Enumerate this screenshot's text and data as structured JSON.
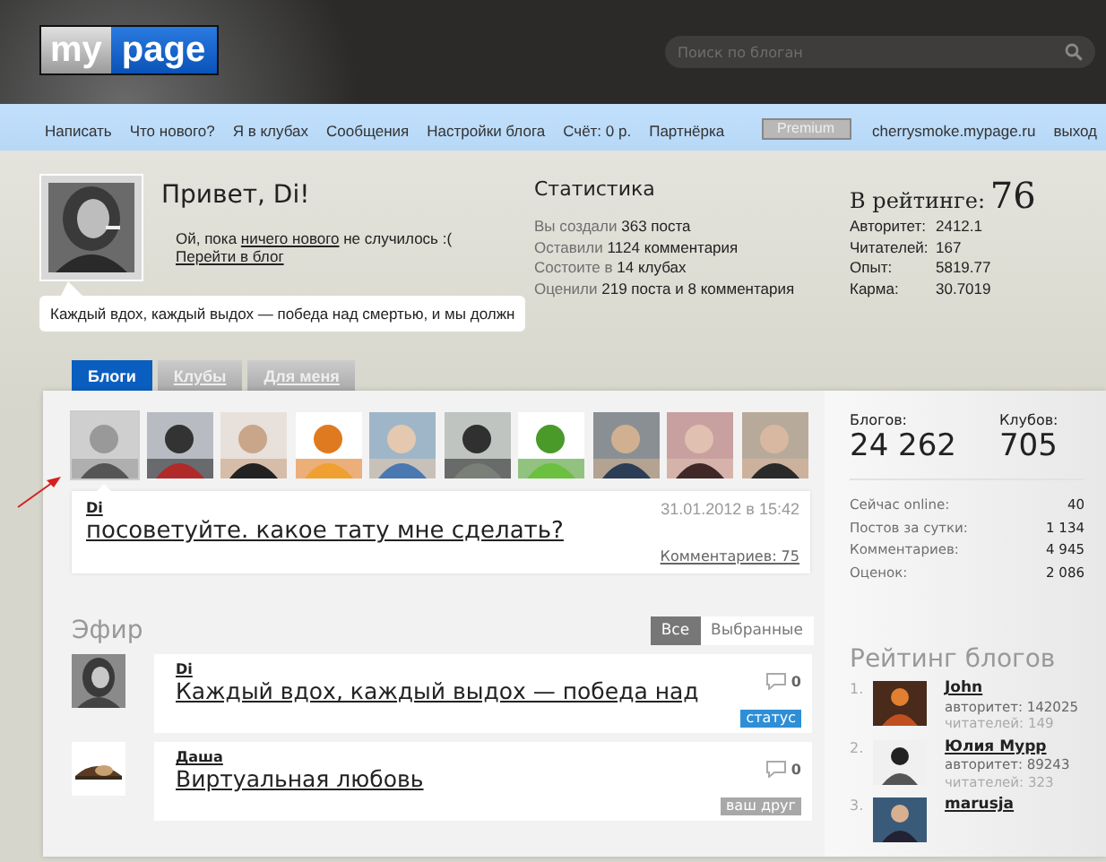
{
  "header": {
    "logo_left": "my",
    "logo_right": "page",
    "search": {
      "placeholder": "Поиск по блоган"
    }
  },
  "nav": {
    "items": [
      "Написать",
      "Что нового?",
      "Я в клубах",
      "Сообщения",
      "Настройки блога",
      "Счёт: 0 р.",
      "Партнёрка"
    ],
    "premium": "Premium",
    "user": "cherrysmoke.mypage.ru",
    "logout": "выход"
  },
  "profile": {
    "greeting": "Привет, Di!",
    "message_before": "Ой, пока ",
    "message_link": "ничего нового",
    "message_after": " не случилось :(",
    "blog_link": "Перейти в блог",
    "status": "Каждый вдох, каждый выдох — победа над смертью, и мы должн"
  },
  "stats": {
    "title": "Статистика",
    "lines": [
      {
        "label": "Вы создали",
        "value": "363 поста"
      },
      {
        "label": "Оставили",
        "value": "1124 комментария"
      },
      {
        "label": "Состоите в",
        "value": "14 клубах"
      },
      {
        "label": "Оценили",
        "value": "219 поста и 8 комментария"
      }
    ]
  },
  "rating": {
    "label": "В рейтинге:",
    "value": "76",
    "rows": [
      {
        "label": "Авторитет:",
        "value": "2412.1"
      },
      {
        "label": "Читателей:",
        "value": "167"
      },
      {
        "label": "Опыт:",
        "value": "5819.77"
      },
      {
        "label": "Карма:",
        "value": "30.7019"
      }
    ]
  },
  "tabs": [
    {
      "label": "Блоги",
      "selected": true
    },
    {
      "label": "Клубы",
      "selected": false
    },
    {
      "label": "Для меня",
      "selected": false
    }
  ],
  "avatars": [
    {
      "kind": "picture",
      "selected": true
    },
    {
      "kind": "picture",
      "selected": false
    },
    {
      "kind": "picture",
      "selected": false
    },
    {
      "kind": "picture",
      "selected": false
    },
    {
      "kind": "picture",
      "selected": false
    },
    {
      "kind": "picture",
      "selected": false
    },
    {
      "kind": "picture",
      "selected": false
    },
    {
      "kind": "picture",
      "selected": false
    },
    {
      "kind": "picture",
      "selected": false
    },
    {
      "kind": "picture",
      "selected": false
    }
  ],
  "post": {
    "author": "Di",
    "date": "31.01.2012 в 15:42",
    "title": "посоветуйте. какое тату мне сделать?",
    "comments": "Комментариев: 75"
  },
  "summary": [
    {
      "label": "Блогов:",
      "value": "24 262"
    },
    {
      "label": "Клубов:",
      "value": "705"
    }
  ],
  "counters": [
    {
      "label": "Сейчас online:",
      "value": "40"
    },
    {
      "label": "Постов за сутки:",
      "value": "1 134"
    },
    {
      "label": "Комментариев:",
      "value": "4 945"
    },
    {
      "label": "Оценок:",
      "value": "2 086"
    }
  ],
  "feed": {
    "title": "Эфир",
    "filters": [
      {
        "label": "Все",
        "selected": true
      },
      {
        "label": "Выбранные",
        "selected": false
      }
    ],
    "items": [
      {
        "author": "Di",
        "title": "Каждый вдох, каждый выдох — победа над",
        "count": "0",
        "tag": "статус",
        "color": "#2e8fd6"
      },
      {
        "author": "Даша",
        "title": "Виртуальная любовь",
        "count": "0",
        "tag": "ваш друг",
        "color": "#a8a8a8"
      }
    ]
  },
  "blog_rating": {
    "title": "Рейтинг блогов",
    "items": [
      {
        "rank": "1.",
        "name": "John",
        "authority": "авторитет: 142025",
        "readers": "читателей: 149"
      },
      {
        "rank": "2.",
        "name": "Юлия Мурр",
        "authority": "авторитет: 89243",
        "readers": "читателей: 323"
      },
      {
        "rank": "3.",
        "name": "marusja"
      }
    ]
  }
}
